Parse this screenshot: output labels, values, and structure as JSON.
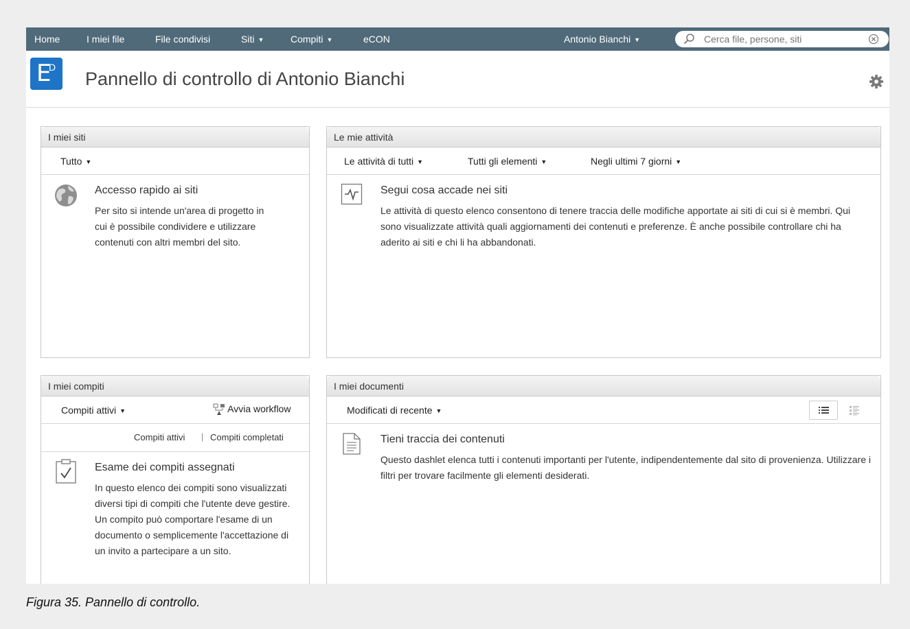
{
  "nav": {
    "home": "Home",
    "my_files": "I miei file",
    "shared_files": "File condivisi",
    "sites": "Siti",
    "tasks": "Compiti",
    "econ": "eCON",
    "user": "Antonio Bianchi"
  },
  "search": {
    "placeholder": "Cerca file, persone, siti"
  },
  "header": {
    "logo_letter": "E",
    "logo_superscript": "D",
    "title": "Pannello di controllo di Antonio Bianchi"
  },
  "my_sites": {
    "title": "I miei siti",
    "filter": "Tutto",
    "heading": "Accesso rapido ai siti",
    "text": "Per sito si intende un'area di progetto in cui è possibile condividere e utilizzare contenuti con altri membri del sito.",
    "icon": "globe-icon"
  },
  "my_activities": {
    "title": "Le mie attività",
    "filter_who": "Le attività di tutti",
    "filter_what": "Tutti gli elementi",
    "filter_when": "Negli ultimi 7 giorni",
    "heading": "Segui cosa accade nei siti",
    "text": "Le attività di questo elenco consentono di tenere traccia delle modifiche apportate ai siti di cui si è membri. Qui sono visualizzate attività quali aggiornamenti dei contenuti e preferenze. È anche possibile controllare chi ha aderito ai siti e chi li ha abbandonati.",
    "icon": "activity-icon"
  },
  "my_tasks": {
    "title": "I miei compiti",
    "filter": "Compiti attivi",
    "start_workflow": "Avvia workflow",
    "link_active": "Compiti attivi",
    "separator": "|",
    "link_completed": "Compiti completati",
    "heading": "Esame dei compiti assegnati",
    "text": "In questo elenco dei compiti sono visualizzati diversi tipi di compiti che l'utente deve gestire. Un compito può comportare l'esame di un documento o semplicemente l'accettazione di un invito a partecipare a un sito.",
    "icon": "clipboard-check-icon"
  },
  "my_documents": {
    "title": "I miei documenti",
    "filter": "Modificati di recente",
    "heading": "Tieni traccia dei contenuti",
    "text": "Questo dashlet elenca tutti i contenuti importanti per l'utente, indipendentemente dal sito di provenienza. Utilizzare i filtri per trovare facilmente gli elementi desiderati.",
    "icon": "document-icon"
  },
  "caption": "Figura 35. Pannello di controllo.",
  "colors": {
    "nav_bg": "#506a79",
    "logo_bg": "#1e74c6",
    "page_bg": "#eeeeee"
  }
}
